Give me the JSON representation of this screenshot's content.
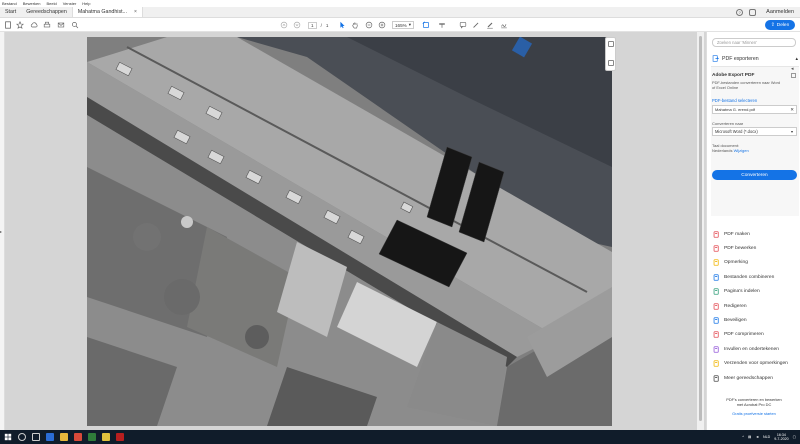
{
  "menu": [
    "Bestand",
    "Bewerken",
    "Beeld",
    "Venster",
    "Help"
  ],
  "tabs": {
    "start": "Start",
    "tools": "Gereedschappen",
    "document": "Mahatma Gandhist...",
    "document_close": "×"
  },
  "header_right": {
    "help": "?",
    "login": "Aanmelden"
  },
  "toolbar": {
    "page_current": "1",
    "page_separator": "/",
    "page_total": "1",
    "zoom": "165%",
    "share": "Delen"
  },
  "right_panel": {
    "search_placeholder": "Zoeken naar 'Minnen'",
    "export_header": "PDF exporteren",
    "export_title": "Adobe Export PDF",
    "export_desc": "PDF-bestanden converteren naar Word of Excel Online",
    "select_file": "PDF-bestand selecteren",
    "file_name": "Mahatma G. erend.pdf",
    "convert_to_label": "Converteren naar",
    "convert_to_value": "Microsoft Word (*.docx)",
    "doc_language_label": "Taal document:",
    "doc_language_value": "Nederlands",
    "change_link": "Wijzigen",
    "convert_button": "Converteren",
    "tools": [
      {
        "label": "PDF maken",
        "icon": "create-pdf-icon",
        "color": "#e34850"
      },
      {
        "label": "PDF bewerken",
        "icon": "edit-pdf-icon",
        "color": "#e34850"
      },
      {
        "label": "Opmerking",
        "icon": "comment-icon",
        "color": "#f0b400"
      },
      {
        "label": "Bestanden combineren",
        "icon": "combine-files-icon",
        "color": "#1473e6"
      },
      {
        "label": "Pagina's indelen",
        "icon": "organize-pages-icon",
        "color": "#2d9d78"
      },
      {
        "label": "Redigeren",
        "icon": "redact-icon",
        "color": "#e34850"
      },
      {
        "label": "Beveiligen",
        "icon": "protect-icon",
        "color": "#1473e6"
      },
      {
        "label": "PDF comprimeren",
        "icon": "compress-pdf-icon",
        "color": "#e34850"
      },
      {
        "label": "Invullen en ondertekenen",
        "icon": "fill-sign-icon",
        "color": "#9256d9"
      },
      {
        "label": "Verzenden voor opmerkingen",
        "icon": "send-comments-icon",
        "color": "#f0b400"
      },
      {
        "label": "Meer gereedschappen",
        "icon": "more-tools-icon",
        "color": "#444444"
      }
    ],
    "promo_line1": "PDF's converteren en bewerken",
    "promo_line2": "met Acrobat Pro DC",
    "promo_trial": "Gratis proefversie starten"
  },
  "taskbar": {
    "time": "16:34",
    "date": "9-7-2020",
    "lang": "NLD"
  },
  "colors": {
    "accent": "#1473e6",
    "taskbar": "#101c2a"
  }
}
